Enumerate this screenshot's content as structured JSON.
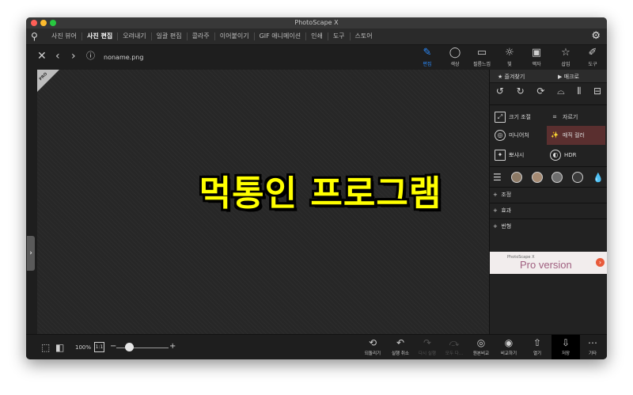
{
  "window": {
    "title": "PhotoScape X"
  },
  "menu": {
    "items": [
      "사진 뷰어",
      "사진 편집",
      "오려내기",
      "일괄 편집",
      "콜라주",
      "이어붙이기",
      "GIF 애니메이션",
      "인쇄",
      "도구",
      "스토어"
    ],
    "active": "사진 편집"
  },
  "file": {
    "name": "noname.png"
  },
  "tools": [
    {
      "label": "편집",
      "icon": "edit-icon"
    },
    {
      "label": "색상",
      "icon": "color-icon"
    },
    {
      "label": "필름느낌",
      "icon": "film-icon"
    },
    {
      "label": "빛",
      "icon": "light-icon"
    },
    {
      "label": "액자",
      "icon": "frame-icon"
    },
    {
      "label": "삽입",
      "icon": "insert-icon"
    },
    {
      "label": "도구",
      "icon": "tools-icon"
    }
  ],
  "panel": {
    "favorites": "즐겨찾기",
    "macro": "매크로",
    "functions": [
      "크기 조절",
      "자르기",
      "미니어처",
      "매직 컬러",
      "뽀샤시",
      "HDR"
    ],
    "sections": [
      "조정",
      "효과",
      "번형"
    ],
    "banner_small": "PhotoScape X",
    "banner_big": "Pro version"
  },
  "overlay_text": "먹통인 프로그램",
  "pro_badge": "PRO",
  "zoom": {
    "level": "100%",
    "one_to_one": "1:1",
    "slider_value": 0.2
  },
  "actions": [
    {
      "label": "되돌리기",
      "icon": "revert-icon",
      "enabled": true
    },
    {
      "label": "실행 취소",
      "icon": "undo-icon",
      "enabled": true
    },
    {
      "label": "다시 실행",
      "icon": "redo-icon",
      "enabled": false
    },
    {
      "label": "모두 다...",
      "icon": "redo-all-icon",
      "enabled": false
    },
    {
      "label": "원본비교",
      "icon": "compare-original-icon",
      "enabled": true
    },
    {
      "label": "비교하기",
      "icon": "compare-icon",
      "enabled": true
    },
    {
      "label": "열기",
      "icon": "open-icon",
      "enabled": true
    },
    {
      "label": "저장",
      "icon": "save-icon",
      "enabled": true
    },
    {
      "label": "기타",
      "icon": "more-icon",
      "enabled": true
    }
  ],
  "colors": {
    "accent": "#2b8cff",
    "overlay_text": "#ffff00",
    "highlight": "#5a2f2f"
  }
}
